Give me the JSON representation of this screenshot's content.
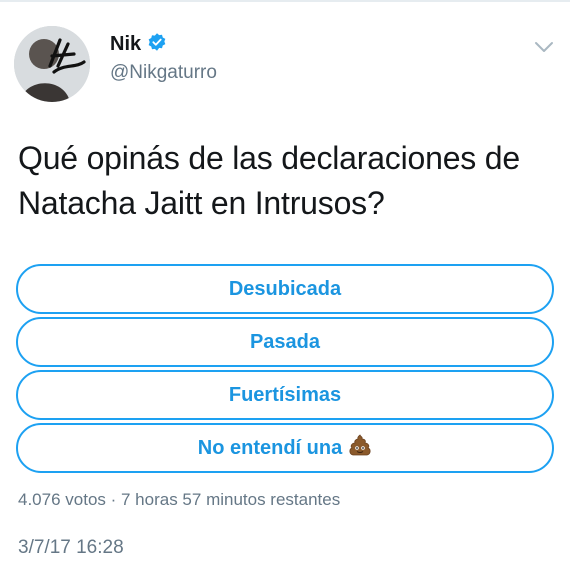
{
  "user": {
    "display_name": "Nik",
    "handle": "@Nikgaturro",
    "verified": true,
    "verified_icon": "verified-badge-icon",
    "menu_icon": "chevron-down-icon"
  },
  "tweet": {
    "text": "Qué opinás de las declaraciones de Natacha Jaitt en Intrusos?",
    "timestamp": "3/7/17 16:28"
  },
  "poll": {
    "options": [
      {
        "label": "Desubicada"
      },
      {
        "label": "Pasada"
      },
      {
        "label": "Fuertísimas"
      },
      {
        "label": "No entendí una",
        "icon": "poop-emoji-icon"
      }
    ],
    "meta": "4.076 votos · 7 horas 57 minutos restantes"
  },
  "colors": {
    "accent": "#1da1f2",
    "accent_text": "#1b95e0",
    "secondary_text": "#657786",
    "primary_text": "#14171a"
  }
}
